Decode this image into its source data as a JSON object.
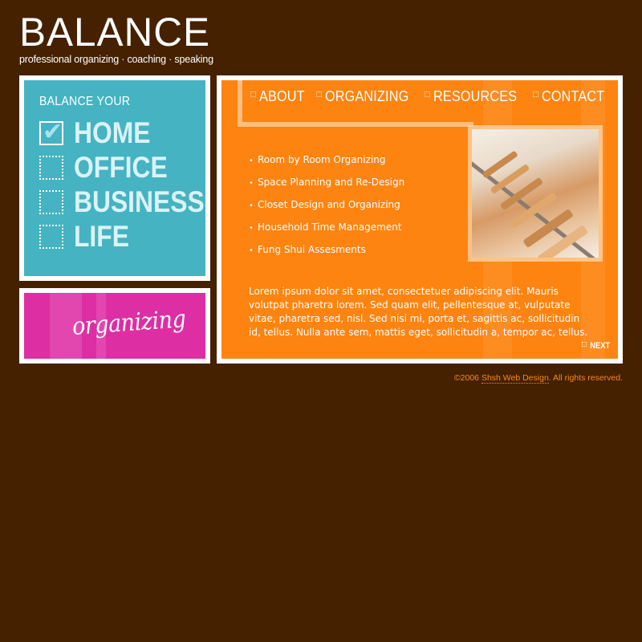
{
  "logo": {
    "title": "BALANCE",
    "tagline": "professional organizing · coaching · speaking"
  },
  "balance_panel": {
    "heading": "BALANCE YOUR",
    "items": [
      {
        "label": "HOME",
        "checked": true
      },
      {
        "label": "OFFICE",
        "checked": false
      },
      {
        "label": "BUSINESS",
        "checked": false
      },
      {
        "label": "LIFE",
        "checked": false
      }
    ],
    "color": "#45b3c2"
  },
  "organizing_panel": {
    "label": "organizing",
    "color": "#dd2ea3"
  },
  "nav": {
    "items": [
      "ABOUT",
      "ORGANIZING",
      "RESOURCES",
      "CONTACT"
    ]
  },
  "main": {
    "color": "#fd8411",
    "services": [
      "Room by Room Organizing",
      "Space Planning and Re-Design",
      "Closet Design and Organizing",
      "Household Time Management",
      "Fung Shui Assesments"
    ],
    "body_text": "Lorem ipsum dolor sit amet, consectetuer adipiscing elit. Mauris volutpat pharetra lorem. Sed quam elit, pellentesque at, vulputate vitae, pharetra sed, nisl. Sed nisi mi, porta et, sagittis ac, sollicitudin id, tellus. Nulla ante sem, mattis eget, sollicitudin a, tempor ac, tellus.",
    "next_label": "NEXT",
    "photo_icon": "closet-hangers-photo"
  },
  "footer": {
    "prefix": "©2006",
    "link": "Shsh Web Design",
    "suffix": ".  All rights reserved."
  }
}
